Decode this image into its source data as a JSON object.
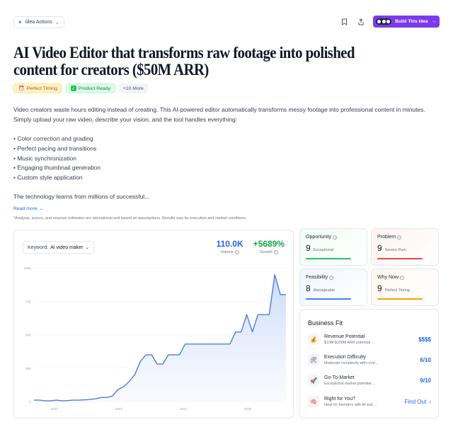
{
  "topbar": {
    "idea_actions_label": "Idea Actions",
    "build_label": "Build This Idea"
  },
  "title": "AI Video Editor that transforms raw footage into polished content for creators ($50M ARR)",
  "tags": [
    "Perfect Timing",
    "Product Ready",
    "+10 More"
  ],
  "description": "Video creators waste hours editing instead of creating. This AI-powered editor automatically transforms messy footage into professional content in minutes. Simply upload your raw video, describe your vision, and the tool handles everything:",
  "bullets": [
    "• Color correction and grading",
    "• Perfect pacing and transitions",
    "• Music synchronization",
    "• Engaging thumbnail generation",
    "• Custom style application"
  ],
  "description_more": "The technology learns from millions of successful...",
  "read_more": "Read more",
  "disclaimer": "*Analysis, scores, and revenue estimates are educational and based on assumptions. Results vary by execution and market conditions.",
  "chart": {
    "keyword_label": "Keyword:",
    "keyword_value": "Ai video maker",
    "volume_value": "110.0K",
    "volume_label": "Volume",
    "growth_value": "+5689%",
    "growth_label": "Growth",
    "accent_color": "#4f7be0",
    "growth_color": "#16a34a"
  },
  "chart_data": {
    "type": "area",
    "x_tick_labels": [
      "2022",
      "2023",
      "2024",
      "2025"
    ],
    "y_tick_labels": [
      "100K",
      "75K",
      "50K",
      "25K",
      "0"
    ],
    "ylim": [
      0,
      100
    ],
    "values": [
      1,
      1,
      0.5,
      0.5,
      1,
      0.5,
      0.7,
      1,
      1,
      1.2,
      1.5,
      2,
      3,
      3,
      4,
      9,
      11,
      15,
      20,
      30,
      35,
      35,
      28,
      28,
      35,
      35,
      35,
      43,
      43,
      43,
      43,
      43,
      43,
      43,
      43,
      43,
      52,
      52,
      65,
      52,
      65,
      65,
      65,
      95,
      80,
      80
    ]
  },
  "metrics": [
    {
      "title": "Opportunity",
      "score": "9",
      "sub": "Exceptional"
    },
    {
      "title": "Problem",
      "score": "9",
      "sub": "Severe Pain"
    },
    {
      "title": "Feasibility",
      "score": "8",
      "sub": "Manageable"
    },
    {
      "title": "Why Now",
      "score": "9",
      "sub": "Perfect Timing"
    }
  ],
  "business_fit": {
    "title": "Business Fit",
    "rows": [
      {
        "icon": "money-bag-icon",
        "label": "Revenue Potential",
        "sub": "$10M-$100M ARR potential ...",
        "value": "$$$$"
      },
      {
        "icon": "tools-icon",
        "label": "Execution Difficulty",
        "sub": "Moderate complexity with cont...",
        "value": "6/10"
      },
      {
        "icon": "rocket-icon",
        "label": "Go-To-Market",
        "sub": "Exceptional market potential ...",
        "value": "9/10"
      },
      {
        "icon": "brain-icon",
        "label": "Right for You?",
        "sub": "Ideal for founders with AI and ...",
        "value": "Find Out"
      }
    ]
  }
}
